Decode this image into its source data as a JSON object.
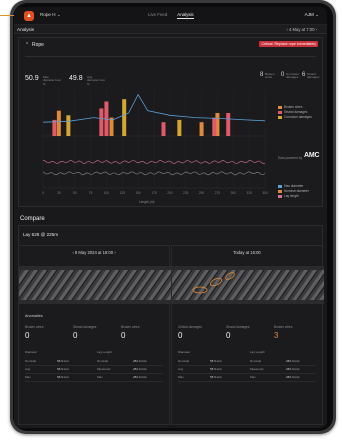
{
  "app": {
    "rope_selector": "Rope H ⌄",
    "tabs": [
      "Live Feed",
      "Analysis"
    ],
    "active_tab": 1,
    "user": "AJM ⌄"
  },
  "analysis": {
    "title": "Analysis",
    "date": "‹   4 May at 7:00   ›"
  },
  "rope_panel": {
    "title": "Rope",
    "badge": "Critical: Replace rope immediately",
    "stats": [
      {
        "value": "50.9",
        "sub": "Max. diameter loss %"
      },
      {
        "value": "49.8",
        "sub": "Avg. diameter loss %"
      }
    ],
    "counts": [
      {
        "value": "8",
        "label": "Broken wires",
        "color": "#e0893a"
      },
      {
        "value": "0",
        "label": "Corrosion damages",
        "color": "#9a9a9e"
      },
      {
        "value": "6",
        "label": "Strand damages",
        "color": "#e0893a"
      }
    ],
    "legend_top": [
      {
        "label": "Broken wires",
        "color": "#e0893a"
      },
      {
        "label": "Strand damages",
        "color": "#e05a6a"
      },
      {
        "label": "Corrosion damages",
        "color": "#d4a82f"
      }
    ],
    "legend_bottom": [
      {
        "label": "Max diameter",
        "color": "#5a9fd6"
      },
      {
        "label": "Nominal diameter",
        "color": "#e0893a"
      },
      {
        "label": "Lay length",
        "color": "#d86f94"
      }
    ],
    "partner_label": "Data powered by",
    "partner": "AMC",
    "x_label": "Length (m)"
  },
  "chart_data": {
    "type": "bar",
    "x": [
      0,
      25,
      50,
      75,
      100,
      125,
      150,
      175,
      200,
      225,
      250,
      275,
      300,
      325,
      350
    ],
    "xlabel": "Length (m)",
    "series": [
      {
        "name": "Broken wires",
        "type": "bar",
        "color": "#e0893a",
        "points": [
          [
            25,
            0.55
          ],
          [
            108,
            0.4
          ],
          [
            250,
            0.3
          ],
          [
            275,
            0.5
          ]
        ]
      },
      {
        "name": "Strand damages",
        "type": "bar",
        "color": "#e05a6a",
        "points": [
          [
            18,
            0.35
          ],
          [
            92,
            0.6
          ],
          [
            100,
            0.75
          ],
          [
            190,
            0.3
          ],
          [
            270,
            0.4
          ],
          [
            292,
            0.5
          ]
        ]
      },
      {
        "name": "Corrosion damages",
        "type": "bar",
        "color": "#d4a82f",
        "points": [
          [
            40,
            0.45
          ],
          [
            128,
            0.8
          ],
          [
            215,
            0.35
          ]
        ]
      },
      {
        "name": "Max diameter",
        "type": "line",
        "color": "#5a9fd6",
        "points": [
          [
            0,
            0.3
          ],
          [
            40,
            0.32
          ],
          [
            80,
            0.4
          ],
          [
            110,
            0.35
          ],
          [
            135,
            0.5
          ],
          [
            150,
            0.9
          ],
          [
            165,
            0.55
          ],
          [
            200,
            0.45
          ],
          [
            240,
            0.4
          ],
          [
            280,
            0.38
          ],
          [
            320,
            0.35
          ],
          [
            350,
            0.33
          ]
        ]
      }
    ],
    "lower_series": [
      {
        "name": "Lay length",
        "color": "#d86f94",
        "level": 0.62
      },
      {
        "name": "Nominal diameter",
        "color": "#8a8a8e",
        "level": 0.35
      }
    ]
  },
  "compare": {
    "section_title": "Compare",
    "subtitle": "Lay 628 @ 225m",
    "left": {
      "header": "‹     8 May 2024 at 16:00     ›",
      "anomalies": "Anomalies",
      "metrics": [
        {
          "label": "Broken wires",
          "value": "0"
        },
        {
          "label": "Strand damages",
          "value": "0"
        },
        {
          "label": "Broken wires",
          "value": "0"
        }
      ],
      "rows": [
        [
          "Diameter",
          "",
          "Lay Length",
          ""
        ],
        [
          "Nominal",
          "58.0 mm",
          "Nominal",
          "282.4 mm"
        ],
        [
          "Avg",
          "58.0 mm",
          "Measured",
          "282.4 mm"
        ],
        [
          "Max",
          "58.0 mm",
          "Max",
          "282.4 mm"
        ]
      ]
    },
    "right": {
      "header": "Today at 16:00",
      "metrics": [
        {
          "label": "Critical damages",
          "value": "0"
        },
        {
          "label": "Strand damages",
          "value": "0"
        },
        {
          "label": "Broken wires",
          "value": "3"
        }
      ],
      "rows": [
        [
          "Diameter",
          "",
          "Lay Length",
          ""
        ],
        [
          "Nominal",
          "58.0 mm",
          "Nominal",
          "282.4 mm"
        ],
        [
          "Avg",
          "58.0 mm",
          "Measured",
          "282.4 mm"
        ],
        [
          "Max",
          "58.0 mm",
          "Max",
          "282.4 mm"
        ]
      ]
    }
  }
}
